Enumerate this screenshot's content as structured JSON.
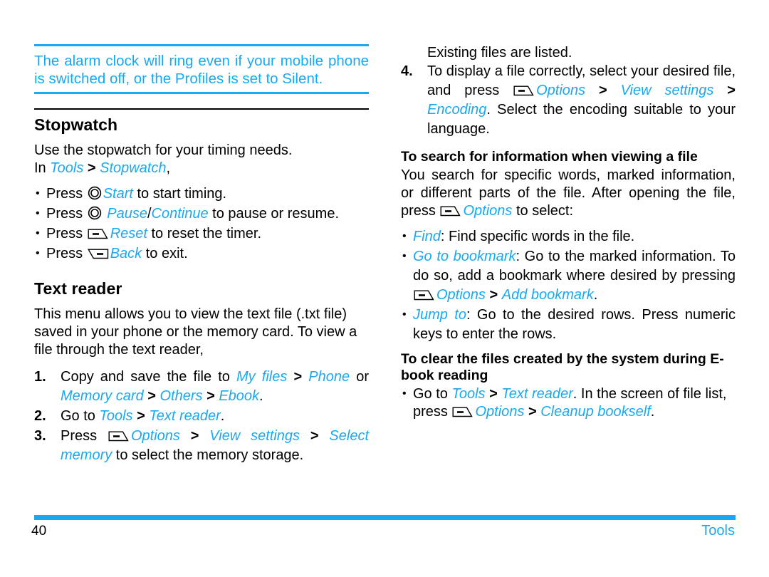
{
  "document": {
    "page_number": "40",
    "section_name": "Tools",
    "accent_color": "#18a9f0",
    "text_color": "#000000"
  },
  "icons": {
    "nav_key": "nav-circle-key-icon",
    "left_soft_key": "left-soft-key-icon",
    "right_soft_key": "right-soft-key-icon"
  },
  "left_column": {
    "note": {
      "text": "The alarm clock will ring even if your mobile phone is switched off, or the Profiles is set to Silent."
    },
    "stopwatch": {
      "heading": "Stopwatch",
      "intro_line1": "Use the stopwatch for your timing needs.",
      "path_prefix": "In ",
      "path_tools": "Tools",
      "path_sep": " > ",
      "path_stopwatch": "Stopwatch",
      "path_suffix": ",",
      "bullets": [
        {
          "press": "Press ",
          "icon": "nav_key",
          "label": "Start",
          "tail": " to start timing."
        },
        {
          "press": "Press ",
          "icon": "nav_key",
          "label": "Pause",
          "label2": "Continue",
          "separator": "/",
          "tail": " to pause or resume."
        },
        {
          "press": "Press ",
          "icon": "left_soft_key",
          "label": "Reset",
          "tail": " to reset the timer."
        },
        {
          "press": "Press ",
          "icon": "right_soft_key",
          "label": "Back",
          "tail": " to exit."
        }
      ]
    },
    "text_reader": {
      "heading": "Text reader",
      "intro": "This menu allows you to view the text file (.txt file) saved in your phone or the memory card. To view a  file through the text reader,",
      "steps": [
        {
          "num": "1.",
          "pre": "Copy and save the file to  ",
          "link1": "My files",
          "sep1": " > ",
          "link2": "Phone",
          "mid": " or ",
          "link3": "Memory card",
          "sep2": " > ",
          "link4": "Others",
          "sep3": " > ",
          "link5": "Ebook",
          "post": "."
        },
        {
          "num": "2.",
          "pre": "Go to ",
          "link1": "Tools",
          "sep1": " > ",
          "link2": "Text reader",
          "post": "."
        },
        {
          "num": "3.",
          "pre": "Press ",
          "icon": "left_soft_key",
          "link1": "Options",
          "sep1": " > ",
          "link2": "View settings",
          "sep2": " > ",
          "link3": "Select memory",
          "post": " to select the memory storage."
        }
      ]
    }
  },
  "right_column": {
    "continued": {
      "note_line": "Existing files are listed.",
      "step": {
        "num": "4.",
        "pre": "To display a file correctly, select your desired file, and press ",
        "icon": "left_soft_key",
        "link1": "Options",
        "sep1": " > ",
        "link2": "View settings",
        "sep2": " > ",
        "link3": "Encoding",
        "post": ". Select the encoding suitable to your language."
      }
    },
    "search_section": {
      "heading": "To search for information when viewing a file",
      "intro_pre": "You search for specific words, marked information, or different parts of the file. After opening the file, press ",
      "intro_icon": "left_soft_key",
      "intro_link": "Options",
      "intro_post": " to select:",
      "bullets": [
        {
          "link1": "Find",
          "text": ": Find specific words in the file."
        },
        {
          "link1": "Go to bookmark",
          "text": ": Go to the marked information. To do so, add a bookmark where desired by pressing ",
          "icon": "left_soft_key",
          "link2": "Options",
          "sep1": " > ",
          "link3": "Add bookmark",
          "post": "."
        },
        {
          "link1": "Jump to",
          "text": ": Go to the desired rows. Press numeric keys to enter the rows."
        }
      ]
    },
    "clear_section": {
      "heading": "To clear the files created by the system during E-book reading",
      "bullet": {
        "pre": "Go to ",
        "link1": "Tools",
        "sep1": " > ",
        "link2": "Text reader",
        "mid": ". In the screen of file list, press ",
        "icon": "left_soft_key",
        "link3": "Options",
        "sep2": " > ",
        "link4": "Cleanup bookself",
        "post": "."
      }
    }
  }
}
